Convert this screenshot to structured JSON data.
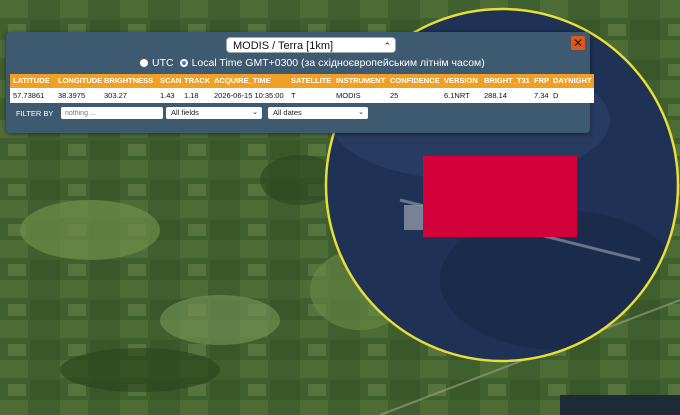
{
  "source": {
    "selected": "MODIS / Terra [1km]"
  },
  "timezone": {
    "utc_label": "UTC",
    "local_label": "Local Time GMT+0300 (за східноєвропейським літнім часом)"
  },
  "table": {
    "columns": [
      "LATITUDE",
      "LONGITUDE",
      "BRIGHTNESS",
      "SCAN",
      "TRACK",
      "ACQUIRE_TIME",
      "SATELLITE",
      "INSTRUMENT",
      "CONFIDENCE",
      "VERSION",
      "BRIGHT_T31",
      "FRP",
      "DAYNIGHT"
    ],
    "rows": [
      [
        "57.73861",
        "38.3975",
        "303.27",
        "1.43",
        "1.18",
        "2026-06-15 10:35:00",
        "T",
        "MODIS",
        "25",
        "6.1NRT",
        "288.14",
        "7.34",
        "D"
      ]
    ]
  },
  "filter": {
    "label": "FILTER BY",
    "placeholder": "nothing ...",
    "fields_select": "All fields",
    "dates_select": "All dates"
  },
  "colors": {
    "header": "#f0a025",
    "panel": "#3e5a70",
    "highlight": "#d4003a",
    "lens_ring": "#e8de3a"
  },
  "icons": {
    "close": "close-icon",
    "chevron": "chevron-down-icon"
  }
}
